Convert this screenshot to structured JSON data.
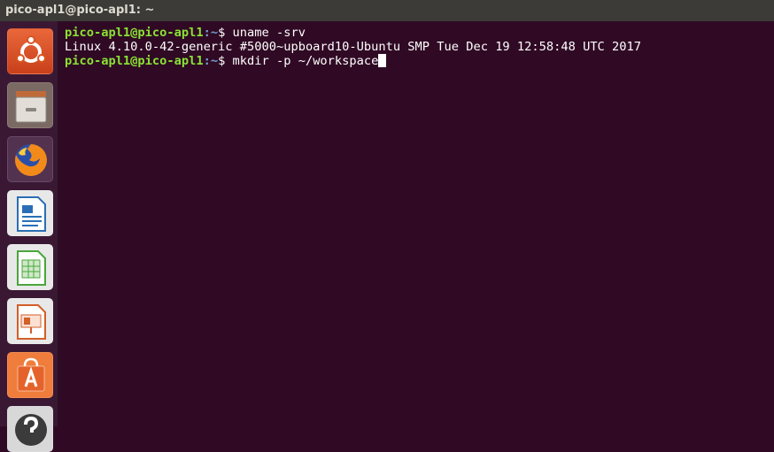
{
  "window": {
    "title": "pico-apl1@pico-apl1: ~"
  },
  "launcher": {
    "items": [
      {
        "name": "ubuntu-dash",
        "icon": "ubuntu-logo-icon",
        "color": "#dd4814"
      },
      {
        "name": "files",
        "icon": "file-cabinet-icon",
        "color": "#d8d4cc"
      },
      {
        "name": "firefox",
        "icon": "firefox-icon",
        "color": "#f28a1a"
      },
      {
        "name": "libreoffice-writer",
        "icon": "document-writer-icon",
        "color": "#2a6fb5"
      },
      {
        "name": "libreoffice-calc",
        "icon": "spreadsheet-calc-icon",
        "color": "#4aa63b"
      },
      {
        "name": "libreoffice-impress",
        "icon": "presentation-impress-icon",
        "color": "#d35f29"
      },
      {
        "name": "ubuntu-software",
        "icon": "software-bag-icon",
        "color": "#e5632b"
      },
      {
        "name": "help",
        "icon": "help-icon",
        "color": "#3b3b3b"
      }
    ]
  },
  "terminal": {
    "line1": {
      "prompt": "pico-apl1@pico-apl1",
      "cwd": ":~",
      "symbol": "$ ",
      "command": "uname -srv"
    },
    "line2": {
      "output": "Linux 4.10.0-42-generic #5000~upboard10-Ubuntu SMP Tue Dec 19 12:58:48 UTC 2017"
    },
    "line3": {
      "prompt": "pico-apl1@pico-apl1",
      "cwd": ":~",
      "symbol": "$ ",
      "command": "mkdir -p ~/workspace"
    },
    "colors": {
      "background": "#300a24",
      "prompt": "#8ae234",
      "text": "#ffffff"
    }
  }
}
